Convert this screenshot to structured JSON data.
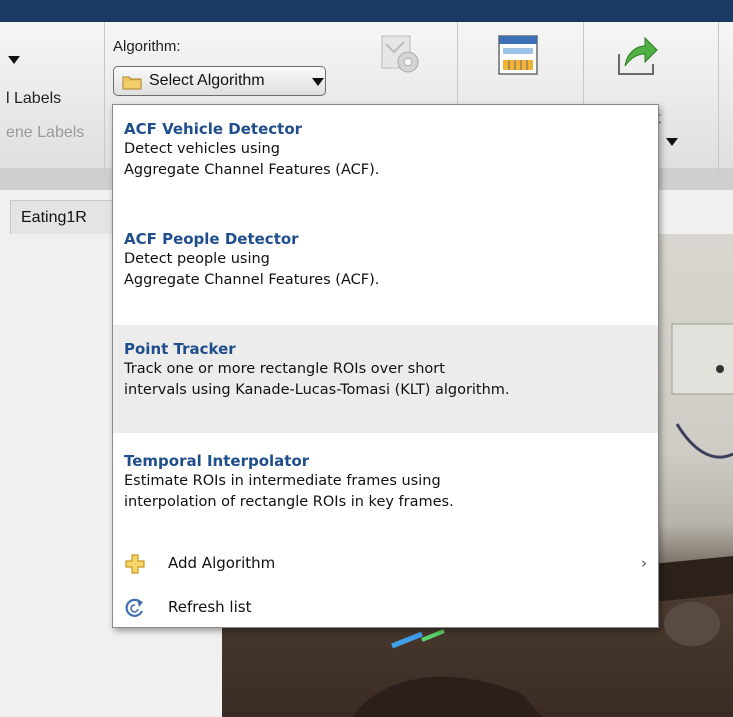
{
  "toolstrip": {
    "partial_label_1": "l Labels",
    "partial_label_2": "ene Labels",
    "algorithm_label": "Algorithm:",
    "select_button_label": "Select Algorithm",
    "partial_right_text": "t"
  },
  "tab": {
    "label": "Eating1R"
  },
  "menu": {
    "items": [
      {
        "title": "ACF Vehicle Detector",
        "desc1": "Detect vehicles using",
        "desc2": "Aggregate Channel Features (ACF)."
      },
      {
        "title": "ACF People Detector",
        "desc1": "Detect people using",
        "desc2": "Aggregate Channel Features (ACF)."
      },
      {
        "title": "Point Tracker",
        "desc1": "Track one or more rectangle ROIs over short",
        "desc2": "intervals using Kanade-Lucas-Tomasi (KLT) algorithm."
      },
      {
        "title": "Temporal Interpolator",
        "desc1": "Estimate ROIs in intermediate frames using",
        "desc2": "interpolation of rectangle ROIs in key frames."
      }
    ],
    "add_algorithm_label": "Add Algorithm",
    "submenu_arrow": "›",
    "refresh_label": "Refresh list"
  },
  "colors": {
    "title_blue": "#1f4e8c",
    "top_bar": "#1b3a63",
    "highlight": "#ececec"
  },
  "icons": {
    "select_button": "folder-icon",
    "toolstrip_1": "gear-settings-icon",
    "toolstrip_2": "view-layout-icon",
    "toolstrip_3": "export-icon",
    "add_algorithm": "plus-icon",
    "refresh": "refresh-icon"
  }
}
